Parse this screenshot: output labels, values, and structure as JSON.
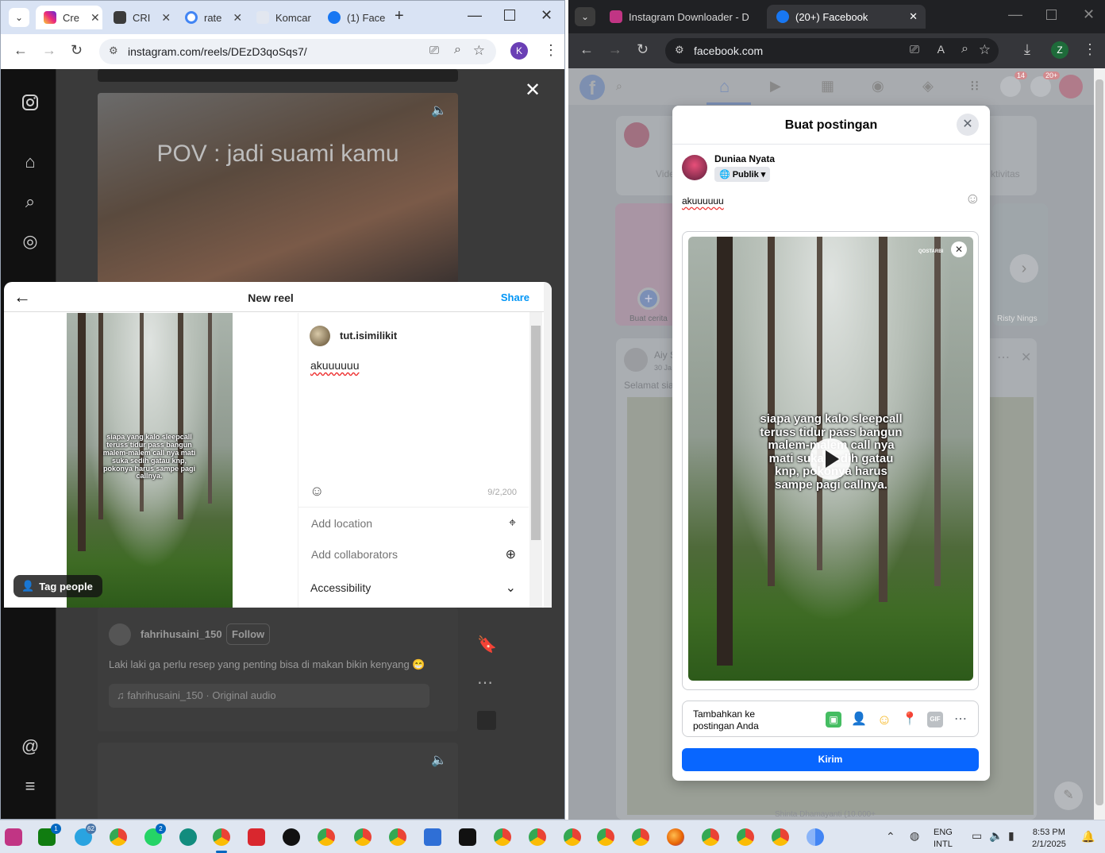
{
  "left_browser": {
    "tabs": [
      {
        "label": "Cre",
        "color": "#e1306c"
      },
      {
        "label": "CRI",
        "color": "#3b3b3b"
      },
      {
        "label": "rate",
        "color": "#4285f4"
      },
      {
        "label": "Komcar",
        "color": "#888888"
      },
      {
        "label": "(1) Face",
        "color": "#1877f2"
      }
    ],
    "url": "instagram.com/reels/DEzD3qoSqs7/",
    "profile_initial": "K"
  },
  "instagram": {
    "reel1_overlay": "POV : jadi suami kamu",
    "reel2": {
      "user": "fahrihusaini_150",
      "follow_label": "Follow",
      "caption": "Laki laki ga perlu resep yang penting bisa di makan bikin kenyang 😁",
      "audio": "fahrihusaini_150 · Original audio"
    },
    "new_reel": {
      "title": "New reel",
      "share_label": "Share",
      "username": "tut.isimilikit",
      "caption": "akuuuuuu",
      "char_count": "9/2,200",
      "add_location": "Add location",
      "add_collaborators": "Add collaborators",
      "accessibility": "Accessibility",
      "tag_people": "Tag people",
      "video_overlay": "siapa yang kalo sleepcall teruss tidur pass bangun malem-malem call nya mati suka sedih gatau knp, pokonya harus sampe pagi callnya."
    }
  },
  "right_browser": {
    "tabs": [
      {
        "label": "Instagram Downloader - D",
        "color": "#c13584"
      },
      {
        "label": "(20+) Facebook",
        "color": "#1877f2"
      }
    ],
    "url": "facebook.com",
    "profile_initial": "Z",
    "badges": {
      "messenger": "14",
      "notifications": "20+"
    }
  },
  "facebook": {
    "background": {
      "story_label": "Buat cerita",
      "story_name": "Risty Nings",
      "post_user": "Aiy S",
      "post_date": "30 Ja",
      "post_text": "Selamat sian",
      "activity_label": "ktivitas",
      "video_label": "Vide",
      "comment_name": "Shinta Dhamayanti (10.000+"
    },
    "dialog": {
      "title": "Buat postingan",
      "user_name": "Duniaa Nyata",
      "audience": "Publik",
      "text": "akuuuuuu",
      "video_overlay": "siapa yang kalo sleepcall teruss tidur pass bangun malem-malem call nya mati suka sedih gatau knp, pokonya harus sampe pagi callnya.",
      "video_watermark": "QOSTARBI",
      "add_to_post": "Tambahkan ke postingan Anda",
      "post_button": "Kirim"
    }
  },
  "taskbar": {
    "badges": {
      "telegram": "62",
      "whatsapp": "2",
      "xbox": "1"
    },
    "lang_line1": "ENG",
    "lang_line2": "INTL",
    "time": "8:53 PM",
    "date": "2/1/2025"
  }
}
